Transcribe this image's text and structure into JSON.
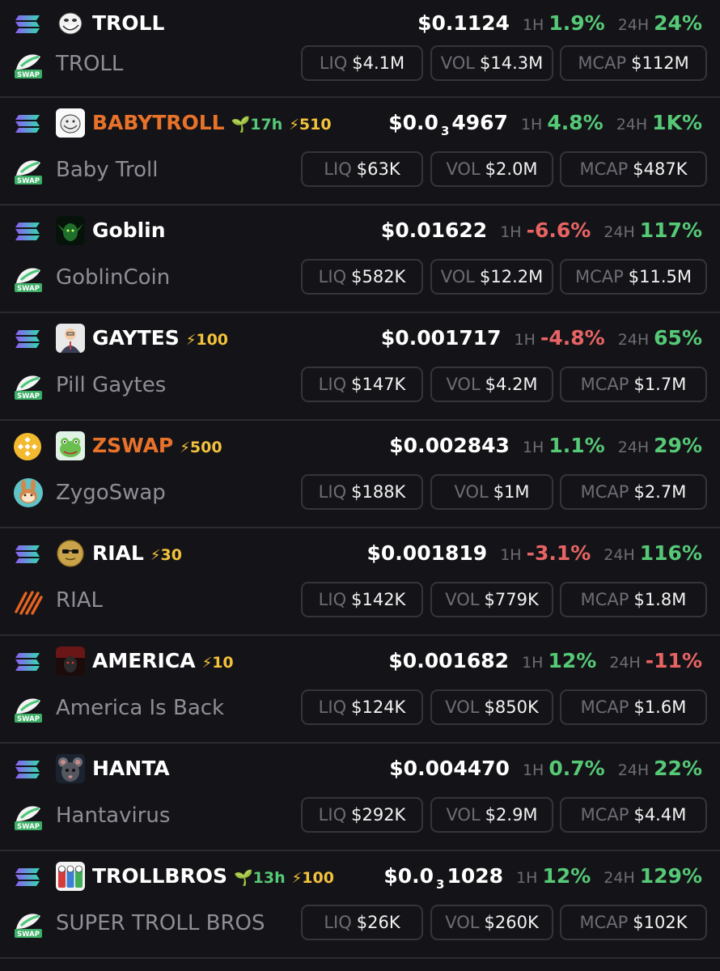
{
  "labels": {
    "h1": "1H",
    "h24": "24H",
    "liq": "LIQ",
    "vol": "VOL",
    "mcap": "MCAP"
  },
  "colors": {
    "up": "#56c977",
    "down": "#e86464",
    "highlight_ticker": "#e8722a",
    "boost": "#f3c23c"
  },
  "rows": [
    {
      "ticker": "TROLL",
      "name": "TROLL",
      "chain_icon": "solana-icon",
      "dex_icon": "swap-icon",
      "avatar": "troll-face-avatar",
      "age": "",
      "boost": "",
      "price_prefix": "$0.1124",
      "price_sub": "",
      "price_suffix": "",
      "h1": "1.9%",
      "h1_dir": "up",
      "h24": "24%",
      "h24_dir": "up",
      "liq": "$4.1M",
      "vol": "$14.3M",
      "mcap": "$112M",
      "highlight": false
    },
    {
      "ticker": "BABYTROLL",
      "name": "Baby Troll",
      "chain_icon": "solana-icon",
      "dex_icon": "swap-icon",
      "avatar": "baby-troll-avatar",
      "age": "17h",
      "boost": "510",
      "price_prefix": "$0.0",
      "price_sub": "3",
      "price_suffix": "4967",
      "h1": "4.8%",
      "h1_dir": "up",
      "h24": "1K%",
      "h24_dir": "up",
      "liq": "$63K",
      "vol": "$2.0M",
      "mcap": "$487K",
      "highlight": true
    },
    {
      "ticker": "Goblin",
      "name": "GoblinCoin",
      "chain_icon": "solana-icon",
      "dex_icon": "swap-icon",
      "avatar": "goblin-avatar",
      "age": "",
      "boost": "",
      "price_prefix": "$0.01622",
      "price_sub": "",
      "price_suffix": "",
      "h1": "-6.6%",
      "h1_dir": "down",
      "h24": "117%",
      "h24_dir": "up",
      "liq": "$582K",
      "vol": "$12.2M",
      "mcap": "$11.5M",
      "highlight": false
    },
    {
      "ticker": "GAYTES",
      "name": "Pill Gaytes",
      "chain_icon": "solana-icon",
      "dex_icon": "swap-icon",
      "avatar": "gaytes-avatar",
      "age": "",
      "boost": "100",
      "price_prefix": "$0.001717",
      "price_sub": "",
      "price_suffix": "",
      "h1": "-4.8%",
      "h1_dir": "down",
      "h24": "65%",
      "h24_dir": "up",
      "liq": "$147K",
      "vol": "$4.2M",
      "mcap": "$1.7M",
      "highlight": false
    },
    {
      "ticker": "ZSWAP",
      "name": "ZygoSwap",
      "chain_icon": "bnb-icon",
      "dex_icon": "pancakeswap-icon",
      "avatar": "frog-avatar",
      "age": "",
      "boost": "500",
      "price_prefix": "$0.002843",
      "price_sub": "",
      "price_suffix": "",
      "h1": "1.1%",
      "h1_dir": "up",
      "h24": "29%",
      "h24_dir": "up",
      "liq": "$188K",
      "vol": "$1M",
      "mcap": "$2.7M",
      "highlight": true
    },
    {
      "ticker": "RIAL",
      "name": "RIAL",
      "chain_icon": "solana-icon",
      "dex_icon": "stripes-dex-icon",
      "avatar": "sunglasses-coin-avatar",
      "age": "",
      "boost": "30",
      "price_prefix": "$0.001819",
      "price_sub": "",
      "price_suffix": "",
      "h1": "-3.1%",
      "h1_dir": "down",
      "h24": "116%",
      "h24_dir": "up",
      "liq": "$142K",
      "vol": "$779K",
      "mcap": "$1.8M",
      "highlight": false
    },
    {
      "ticker": "AMERICA",
      "name": "America Is Back",
      "chain_icon": "solana-icon",
      "dex_icon": "swap-icon",
      "avatar": "america-avatar",
      "age": "",
      "boost": "10",
      "price_prefix": "$0.001682",
      "price_sub": "",
      "price_suffix": "",
      "h1": "12%",
      "h1_dir": "up",
      "h24": "-11%",
      "h24_dir": "down",
      "liq": "$124K",
      "vol": "$850K",
      "mcap": "$1.6M",
      "highlight": false
    },
    {
      "ticker": "HANTA",
      "name": "Hantavirus",
      "chain_icon": "solana-icon",
      "dex_icon": "swap-icon",
      "avatar": "rat-avatar",
      "age": "",
      "boost": "",
      "price_prefix": "$0.004470",
      "price_sub": "",
      "price_suffix": "",
      "h1": "0.7%",
      "h1_dir": "up",
      "h24": "22%",
      "h24_dir": "up",
      "liq": "$292K",
      "vol": "$2.9M",
      "mcap": "$4.4M",
      "highlight": false
    },
    {
      "ticker": "TROLLBROS",
      "name": "SUPER TROLL BROS",
      "chain_icon": "solana-icon",
      "dex_icon": "swap-icon",
      "avatar": "troll-bros-avatar",
      "age": "13h",
      "boost": "100",
      "price_prefix": "$0.0",
      "price_sub": "3",
      "price_suffix": "1028",
      "h1": "12%",
      "h1_dir": "up",
      "h24": "129%",
      "h24_dir": "up",
      "liq": "$26K",
      "vol": "$260K",
      "mcap": "$102K",
      "highlight": false
    }
  ]
}
